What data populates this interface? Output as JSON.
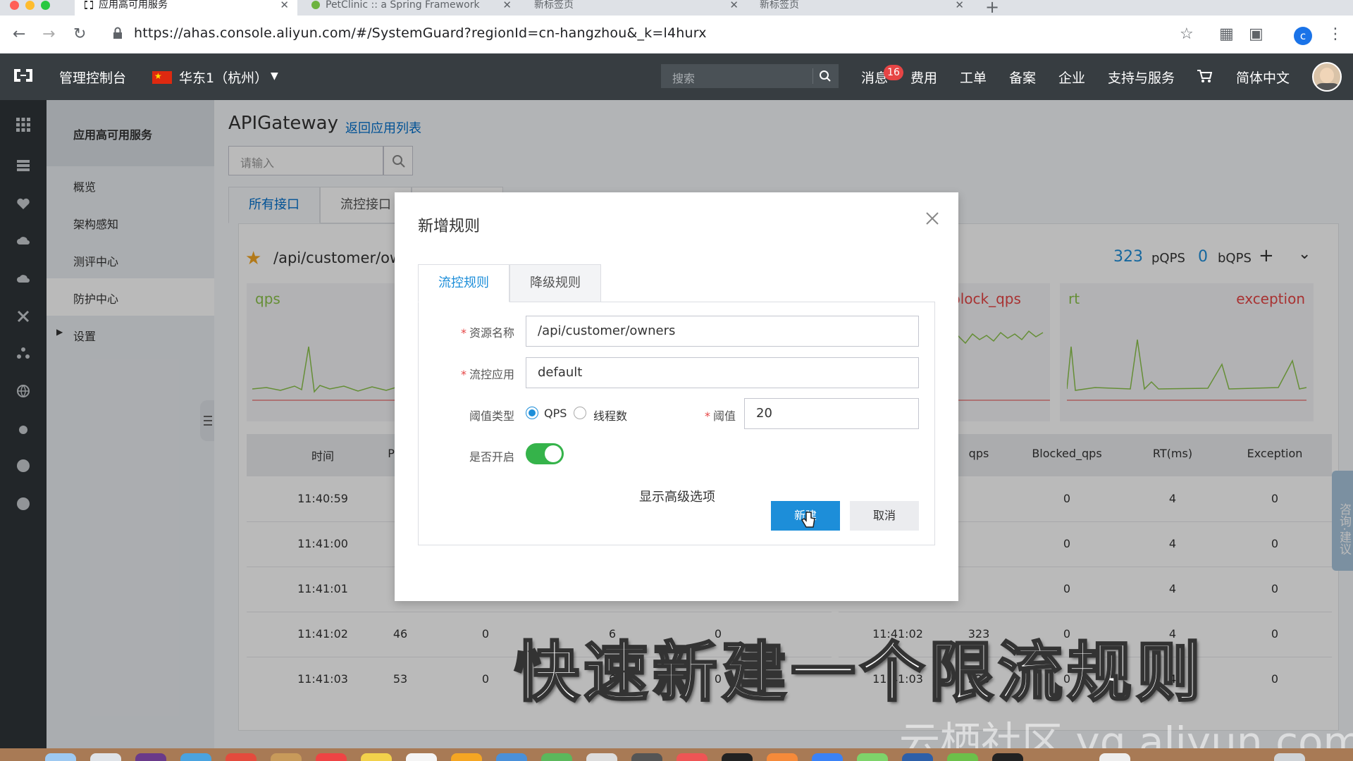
{
  "browser": {
    "tabs": [
      {
        "title": "应用高可用服务",
        "active": true
      },
      {
        "title": "PetClinic :: a Spring Framework",
        "active": false
      },
      {
        "title": "新标签页",
        "active": false
      },
      {
        "title": "新标签页",
        "active": false
      }
    ],
    "url": "https://ahas.console.aliyun.com/#/SystemGuard?regionId=cn-hangzhou&_k=l4hurx",
    "profile_initial": "c"
  },
  "topbar": {
    "console_label": "管理控制台",
    "region": "华东1（杭州）",
    "search_placeholder": "搜索",
    "nav": [
      "消息",
      "费用",
      "工单",
      "备案",
      "企业",
      "支持与服务",
      "简体中文"
    ],
    "message_badge": "16"
  },
  "sidebar": {
    "header": "应用高可用服务",
    "items": [
      {
        "label": "概览",
        "active": false
      },
      {
        "label": "架构感知",
        "active": false
      },
      {
        "label": "测评中心",
        "active": false
      },
      {
        "label": "防护中心",
        "active": true
      },
      {
        "label": "设置",
        "active": false
      }
    ]
  },
  "main": {
    "title": "APIGateway",
    "back_link": "返回应用列表",
    "search_placeholder": "请输入",
    "tabs": [
      "所有接口",
      "流控接口"
    ],
    "api_name": "/api/customer/owners",
    "pqps_value": "323",
    "pqps_label": "pQPS",
    "bqps_value": "0",
    "bqps_label": "bQPS",
    "left_chart_label": "qps",
    "right_chart_labels": [
      "block_qps",
      "rt",
      "exception"
    ],
    "left_table": {
      "headers": [
        "时间",
        "Pass"
      ],
      "rows": [
        [
          "11:40:59",
          "",
          "",
          "",
          ""
        ],
        [
          "11:41:00",
          "",
          "",
          "",
          ""
        ],
        [
          "11:41:01",
          "",
          "",
          "",
          ""
        ],
        [
          "11:41:02",
          "46",
          "0",
          "6",
          "0"
        ],
        [
          "11:41:03",
          "53",
          "0",
          "6",
          "0"
        ]
      ]
    },
    "right_table": {
      "headers": [
        "qps",
        "Blocked_qps",
        "RT(ms)",
        "Exception"
      ],
      "rows": [
        [
          "",
          "",
          "0",
          "4",
          "0"
        ],
        [
          "",
          "",
          "0",
          "4",
          "0"
        ],
        [
          "",
          "",
          "0",
          "4",
          "0"
        ],
        [
          "11:41:02",
          "323",
          "0",
          "4",
          "0"
        ],
        [
          "11:41:03",
          "323",
          "0",
          "4",
          "0"
        ]
      ]
    }
  },
  "modal": {
    "title": "新增规则",
    "tabs": [
      "流控规则",
      "降级规则"
    ],
    "fields": {
      "resource_label": "资源名称",
      "resource_value": "/api/customer/owners",
      "app_label": "流控应用",
      "app_value": "default",
      "threshold_type_label": "阈值类型",
      "threshold_type_options": [
        "QPS",
        "线程数"
      ],
      "threshold_label": "阈值",
      "threshold_value": "20",
      "enabled_label": "是否开启"
    },
    "enabled": true,
    "advanced_label": "显示高级选项",
    "create_button": "新建",
    "cancel_button": "取消"
  },
  "overlay_caption": "快速新建一个限流规则",
  "watermark": "云栖社区 yq.aliyun.com",
  "feedback_tab": "咨询·建议"
}
